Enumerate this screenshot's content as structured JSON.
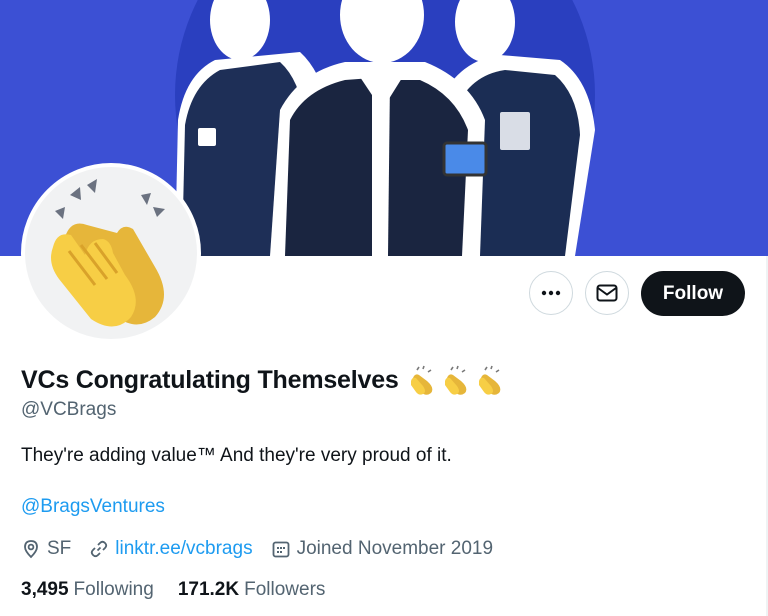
{
  "profile": {
    "display_name": "VCs Congratulating Themselves",
    "name_emojis": [
      "clapping-hands",
      "clapping-hands",
      "clapping-hands"
    ],
    "handle": "@VCBrags",
    "bio": "They're adding value™ And they're very proud of it.",
    "mention": "@BragsVentures",
    "location": "SF",
    "website": "linktr.ee/vcbrags",
    "joined": "Joined November 2019",
    "avatar_icon": "clapping-hands-icon"
  },
  "actions": {
    "more_icon": "more-icon",
    "message_icon": "envelope-icon",
    "follow_label": "Follow"
  },
  "stats": {
    "following_count": "3,495",
    "following_label": "Following",
    "followers_count": "171.2K",
    "followers_label": "Followers"
  },
  "colors": {
    "banner_blue": "#3c50d4",
    "link_blue": "#1d9bf0",
    "text_primary": "#0f1419",
    "text_secondary": "#536471",
    "follow_bg": "#0f1419"
  }
}
